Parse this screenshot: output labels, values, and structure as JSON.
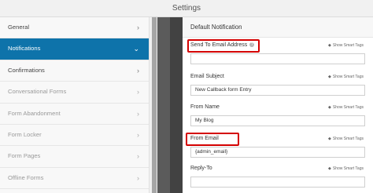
{
  "window": {
    "title": "Settings"
  },
  "sidebar": {
    "items": [
      {
        "label": "General",
        "state": "normal",
        "icon": "chevron-right-icon"
      },
      {
        "label": "Notifications",
        "state": "active",
        "icon": "chevron-down-icon"
      },
      {
        "label": "Confirmations",
        "state": "normal",
        "icon": "chevron-right-icon"
      },
      {
        "label": "Conversational Forms",
        "state": "disabled",
        "icon": "chevron-right-icon"
      },
      {
        "label": "Form Abandonment",
        "state": "disabled",
        "icon": "chevron-right-icon"
      },
      {
        "label": "Form Locker",
        "state": "disabled",
        "icon": "chevron-right-icon"
      },
      {
        "label": "Form Pages",
        "state": "disabled",
        "icon": "chevron-right-icon"
      },
      {
        "label": "Offline Forms",
        "state": "disabled",
        "icon": "chevron-right-icon"
      }
    ]
  },
  "panel": {
    "title": "Default Notification",
    "smart_tags_label": "Show Smart Tags",
    "fields": [
      {
        "label": "Send To Email Address",
        "value": "",
        "has_help": true,
        "highlighted": true
      },
      {
        "label": "Email Subject",
        "value": "New Callback form Entry",
        "has_help": false,
        "highlighted": false
      },
      {
        "label": "From Name",
        "value": "My Blog",
        "has_help": false,
        "highlighted": false
      },
      {
        "label": "From Email",
        "value": "{admin_email}",
        "has_help": false,
        "highlighted": true
      },
      {
        "label": "Reply-To",
        "value": "",
        "has_help": false,
        "highlighted": false
      }
    ]
  },
  "colors": {
    "accent": "#0e73aa",
    "highlight": "#d40000"
  }
}
